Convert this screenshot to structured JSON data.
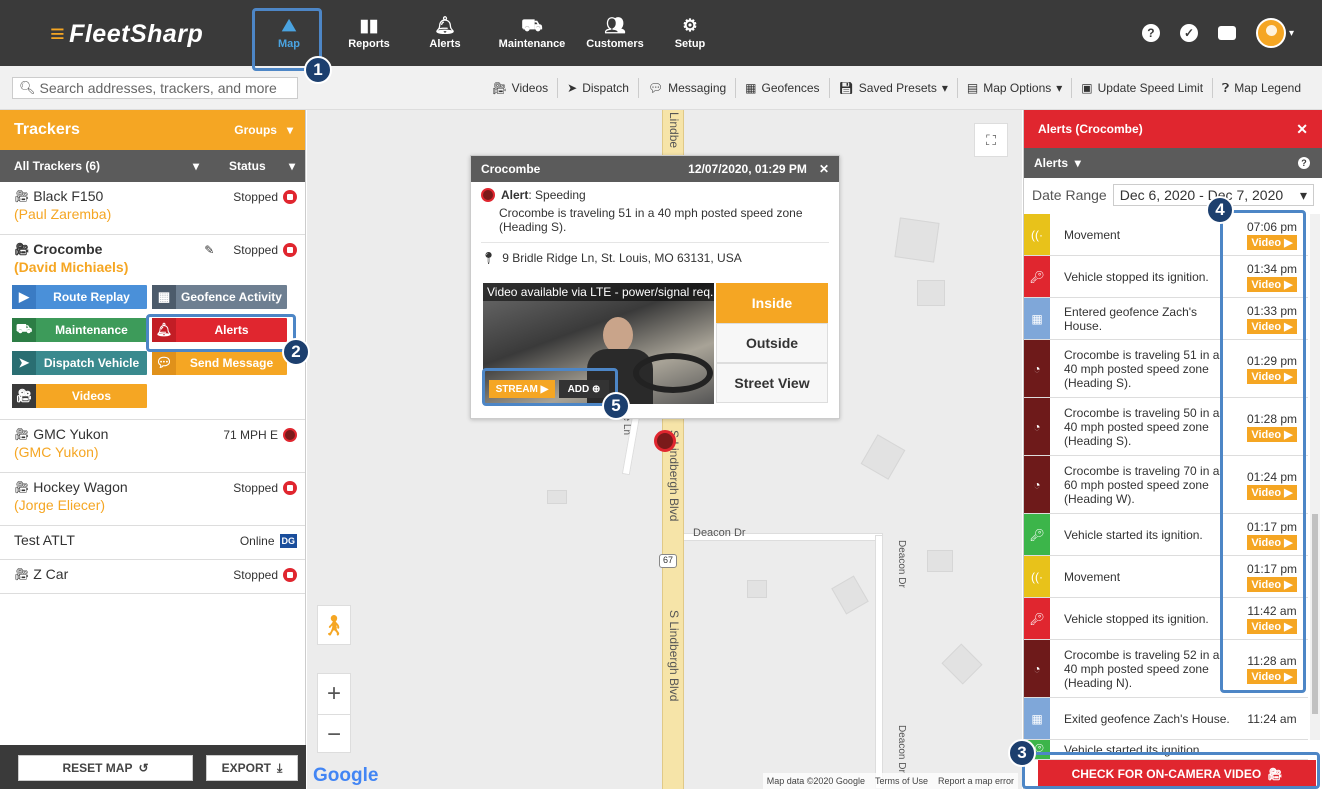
{
  "app": {
    "logo": "FleetSharp"
  },
  "nav": [
    {
      "label": "Map",
      "icon": "map-icon",
      "active": true
    },
    {
      "label": "Reports",
      "icon": "bar-chart-icon"
    },
    {
      "label": "Alerts",
      "icon": "bell-icon"
    },
    {
      "label": "Maintenance",
      "icon": "car-icon"
    },
    {
      "label": "Customers",
      "icon": "users-icon"
    },
    {
      "label": "Setup",
      "icon": "gear-icon"
    }
  ],
  "toolbar": {
    "search_placeholder": "Search addresses, trackers, and more",
    "items": [
      "Videos",
      "Dispatch",
      "Messaging",
      "Geofences",
      "Saved Presets",
      "Map Options",
      "Update Speed Limit",
      "Map Legend"
    ]
  },
  "trackers": {
    "title": "Trackers",
    "groups": "Groups",
    "all_label": "All Trackers (6)",
    "status_label": "Status",
    "list": [
      {
        "name": "Black F150",
        "driver": "(Paul Zaremba)",
        "status": "Stopped"
      },
      {
        "name": "Crocombe",
        "driver": "(David Michiaels)",
        "status": "Stopped"
      },
      {
        "name": "GMC Yukon",
        "driver": "(GMC Yukon)",
        "status": "71 MPH E"
      },
      {
        "name": "Hockey Wagon",
        "driver": "(Jorge Eliecer)",
        "status": "Stopped"
      },
      {
        "name": "Test ATLT",
        "driver": "",
        "status": "Online"
      },
      {
        "name": "Z Car",
        "driver": "",
        "status": "Stopped"
      }
    ],
    "actions": [
      "Route Replay",
      "Geofence Activity",
      "Maintenance",
      "Alerts",
      "Dispatch Vehicle",
      "Send Message",
      "Videos"
    ],
    "dg_badge": "DG",
    "reset_map": "RESET MAP",
    "export": "EXPORT"
  },
  "popup": {
    "title": "Crocombe",
    "datetime": "12/07/2020, 01:29 PM",
    "alert_label": "Alert",
    "alert_type": ": Speeding",
    "alert_desc": "Crocombe is traveling 51 in a 40 mph posted speed zone (Heading S).",
    "address": "9 Bridle Ridge Ln, St. Louis, MO 63131, USA",
    "video_text": "Video available via LTE - power/signal req.",
    "stream": "STREAM",
    "add": "ADD",
    "views": [
      "Inside",
      "Outside",
      "Street View"
    ]
  },
  "map": {
    "road_main": "S Lindbergh Blvd",
    "road_main_top": "Lindbe",
    "road_deacon": "Deacon Dr",
    "road_bridle": "ge Ln",
    "route_num": "67",
    "google": "Google",
    "attribution": [
      "Map data ©2020 Google",
      "Terms of Use",
      "Report a map error"
    ]
  },
  "alerts": {
    "title": "Alerts (Crocombe)",
    "sub": "Alerts",
    "date_label": "Date Range",
    "date_value": "Dec 6, 2020 - Dec 7, 2020",
    "video_label": "Video",
    "check_button": "CHECK FOR ON-CAMERA VIDEO",
    "rows": [
      {
        "type": "movement",
        "color": "#e8c21a",
        "text": "Movement",
        "time": "07:06 pm",
        "video": true
      },
      {
        "type": "ignition-off",
        "color": "#e0262f",
        "text": "Vehicle stopped its ignition.",
        "time": "01:34 pm",
        "video": true
      },
      {
        "type": "geofence",
        "color": "#7fa7d9",
        "text": "Entered geofence Zach's House.",
        "time": "01:33 pm",
        "video": true
      },
      {
        "type": "speed",
        "color": "#6e1a1a",
        "text": "Crocombe is traveling 51 in a 40 mph posted speed zone (Heading S).",
        "time": "01:29 pm",
        "video": true
      },
      {
        "type": "speed",
        "color": "#6e1a1a",
        "text": "Crocombe is traveling 50 in a 40 mph posted speed zone (Heading S).",
        "time": "01:28 pm",
        "video": true
      },
      {
        "type": "speed",
        "color": "#6e1a1a",
        "text": "Crocombe is traveling 70 in a 60 mph posted speed zone (Heading W).",
        "time": "01:24 pm",
        "video": true
      },
      {
        "type": "ignition-on",
        "color": "#3cb54a",
        "text": "Vehicle started its ignition.",
        "time": "01:17 pm",
        "video": true
      },
      {
        "type": "movement",
        "color": "#e8c21a",
        "text": "Movement",
        "time": "01:17 pm",
        "video": true
      },
      {
        "type": "ignition-off",
        "color": "#e0262f",
        "text": "Vehicle stopped its ignition.",
        "time": "11:42 am",
        "video": true
      },
      {
        "type": "speed",
        "color": "#6e1a1a",
        "text": "Crocombe is traveling 52 in a 40 mph posted speed zone (Heading N).",
        "time": "11:28 am",
        "video": true
      },
      {
        "type": "geofence",
        "color": "#7fa7d9",
        "text": "Exited geofence Zach's House.",
        "time": "11:24 am",
        "video": false
      },
      {
        "type": "ignition-on",
        "color": "#3cb54a",
        "text": "Vehicle started its ignition.",
        "time": "",
        "video": false
      }
    ]
  },
  "callouts": [
    "1",
    "2",
    "3",
    "4",
    "5"
  ],
  "colors": {
    "brand_orange": "#f5a623",
    "nav_dark": "#3a3a3a",
    "alert_red": "#e0262f",
    "callout_blue": "#4d86c6"
  }
}
